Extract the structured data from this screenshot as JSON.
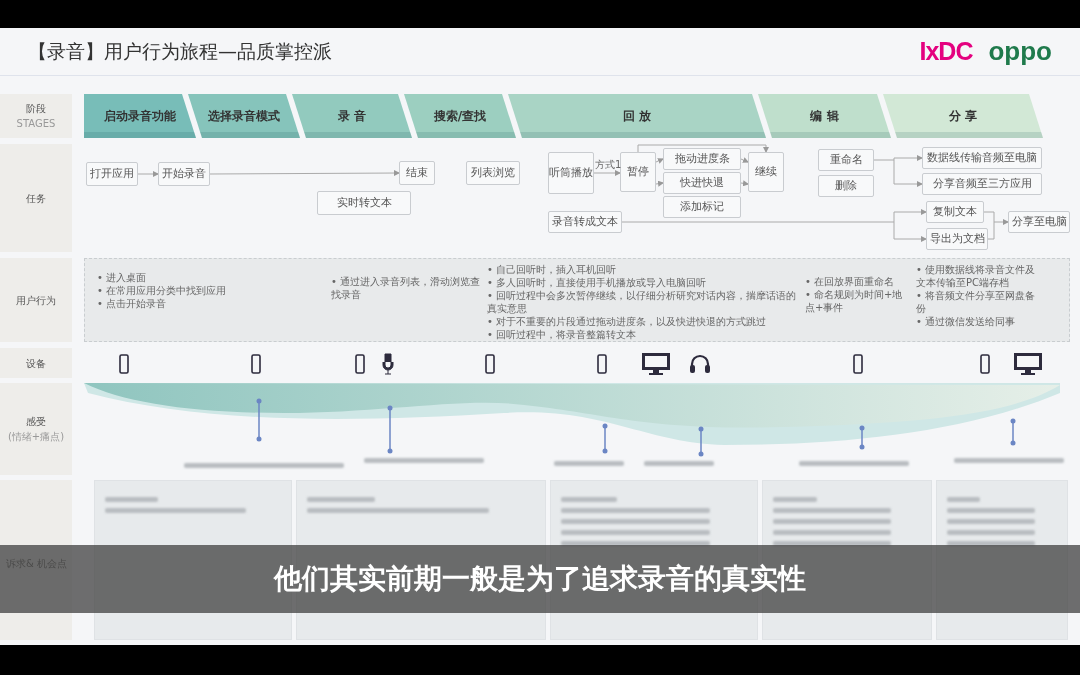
{
  "title": "【录音】用户行为旅程—品质掌控派",
  "logos": [
    {
      "text": "IxDC",
      "kind": "ixdc"
    },
    {
      "text": "oppo",
      "kind": "oppo"
    }
  ],
  "row_labels": [
    {
      "text": "阶段",
      "sub": "STAGES"
    },
    {
      "text": "任务"
    },
    {
      "text": "用户行为"
    },
    {
      "text": "设备"
    },
    {
      "text": "感受",
      "sub": "(情绪+痛点)"
    },
    {
      "text": "诉求& 机会点"
    }
  ],
  "stages": [
    "启动录音功能",
    "选择录音模式",
    "录 音",
    "搜索/查找",
    "回 放",
    "编 辑",
    "分 享"
  ],
  "tasks": [
    "打开应用",
    "开始录音",
    "结束",
    "实时转文本",
    "列表浏览",
    "听筒播放",
    "暂停",
    "拖动进度条",
    "快进快退",
    "添加标记",
    "继续",
    "录音转成文本",
    "重命名",
    "删除",
    "数据线传输音频至电脑",
    "分享音频至三方应用",
    "复制文本",
    "导出为文档",
    "分享至电脑"
  ],
  "task_note": "方式1",
  "behaviors": [
    [
      "• 进入桌面",
      "• 在常用应用分类中找到应用",
      "• 点击开始录音"
    ],
    [
      "• 通过进入录音列表，滑动浏览查找录音"
    ],
    [
      "• 自己回听时，插入耳机回听",
      "• 多人回听时，直接使用手机播放或导入电脑回听",
      "• 回听过程中会多次暂停继续，以仔细分析研究对话内容，揣摩话语的真实意思",
      "• 对于不重要的片段通过拖动进度条，以及快进快退的方式跳过",
      "• 回听过程中，将录音整篇转文本"
    ],
    [
      "• 在回放界面重命名",
      "• 命名规则为时间+地点+事件"
    ],
    [
      "• 使用数据线将录音文件及文本传输至PC端存档",
      "• 将音频文件分享至网盘备份",
      "• 通过微信发送给同事"
    ]
  ],
  "devices": [
    {
      "kind": "phone"
    },
    {
      "kind": "phone"
    },
    {
      "kind": "phone"
    },
    {
      "kind": "microphone"
    },
    {
      "kind": "phone"
    },
    {
      "kind": "phone"
    },
    {
      "kind": "monitor"
    },
    {
      "kind": "headphones"
    },
    {
      "kind": "phone"
    },
    {
      "kind": "phone"
    },
    {
      "kind": "monitor"
    }
  ],
  "subtitle": "他们其实前期一般是为了追求录音的真实性"
}
